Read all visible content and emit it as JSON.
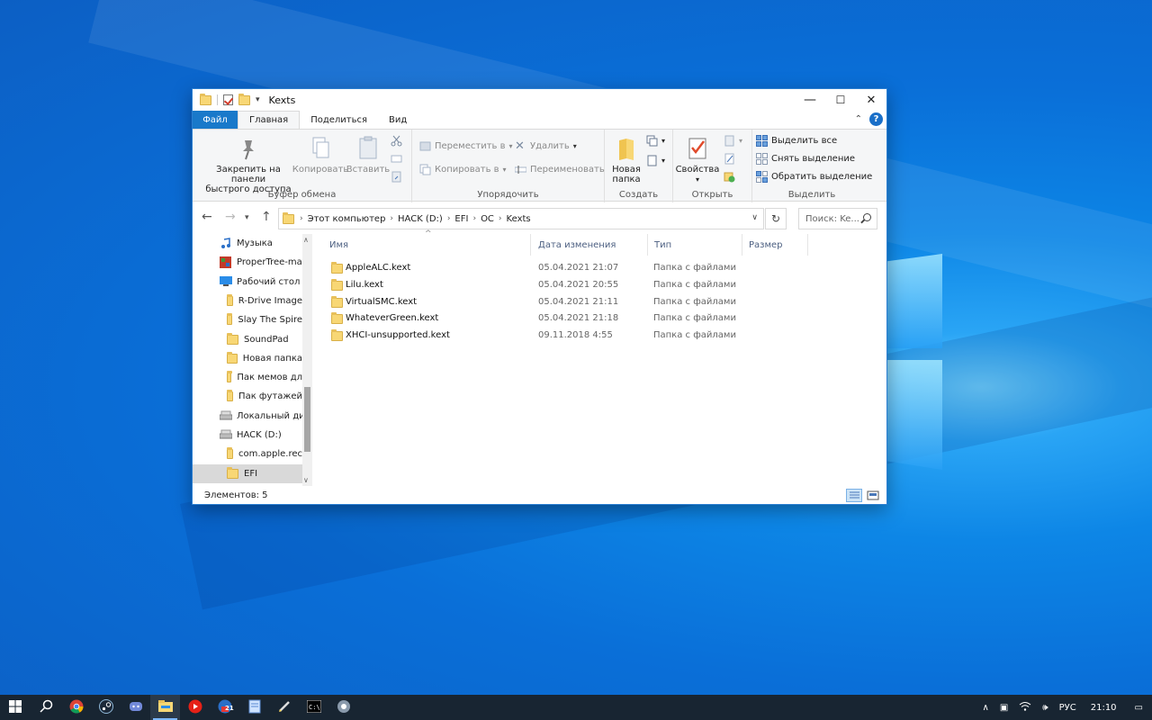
{
  "window": {
    "title": "Kexts",
    "minimize": "—",
    "maximize": "☐",
    "close": "✕"
  },
  "ribbon_tabs": [
    {
      "label": "Файл"
    },
    {
      "label": "Главная"
    },
    {
      "label": "Поделиться"
    },
    {
      "label": "Вид"
    }
  ],
  "ribbon": {
    "clipboard": {
      "group_label": "Буфер обмена",
      "pin": "Закрепить на панели быстрого доступа",
      "pin_line1": "Закрепить на панели",
      "pin_line2": "быстрого доступа",
      "copy": "Копировать",
      "paste": "Вставить"
    },
    "organize": {
      "group_label": "Упорядочить",
      "move_to": "Переместить в",
      "copy_to": "Копировать в",
      "delete": "Удалить",
      "rename": "Переименовать"
    },
    "create": {
      "group_label": "Создать",
      "new_folder_line1": "Новая",
      "new_folder_line2": "папка"
    },
    "open": {
      "group_label": "Открыть",
      "properties": "Свойства"
    },
    "select": {
      "group_label": "Выделить",
      "select_all": "Выделить все",
      "select_none": "Снять выделение",
      "invert": "Обратить выделение"
    }
  },
  "address": {
    "crumbs": [
      "Этот компьютер",
      "HACK (D:)",
      "EFI",
      "OC",
      "Kexts"
    ],
    "search_placeholder": "Поиск: Ke..."
  },
  "nav_pane": [
    {
      "label": "Музыка",
      "icon": "music-icon"
    },
    {
      "label": "ProperTree-ma",
      "icon": "app-icon"
    },
    {
      "label": "Рабочий стол",
      "icon": "desktop-icon"
    },
    {
      "label": "R-Drive Image",
      "icon": "folder-icon"
    },
    {
      "label": "Slay The Spire",
      "icon": "folder-icon"
    },
    {
      "label": "SoundPad",
      "icon": "folder-icon"
    },
    {
      "label": "Новая папка",
      "icon": "folder-icon"
    },
    {
      "label": "Пак мемов дл",
      "icon": "folder-icon"
    },
    {
      "label": "Пак футажей",
      "icon": "folder-icon"
    },
    {
      "label": "Локальный дис",
      "icon": "drive-icon"
    },
    {
      "label": "HACK (D:)",
      "icon": "drive-icon"
    },
    {
      "label": "com.apple.rec",
      "icon": "folder-icon"
    },
    {
      "label": "EFI",
      "icon": "folder-icon",
      "selected": true
    }
  ],
  "columns": {
    "name": "Имя",
    "date": "Дата изменения",
    "type": "Тип",
    "size": "Размер"
  },
  "files": [
    {
      "name": "AppleALC.kext",
      "date": "05.04.2021 21:07",
      "type": "Папка с файлами"
    },
    {
      "name": "Lilu.kext",
      "date": "05.04.2021 20:55",
      "type": "Папка с файлами"
    },
    {
      "name": "VirtualSMC.kext",
      "date": "05.04.2021 21:11",
      "type": "Папка с файлами"
    },
    {
      "name": "WhateverGreen.kext",
      "date": "05.04.2021 21:18",
      "type": "Папка с файлами"
    },
    {
      "name": "XHCI-unsupported.kext",
      "date": "09.11.2018 4:55",
      "type": "Папка с файлами"
    }
  ],
  "status": {
    "items_count": "Элементов: 5"
  },
  "taskbar": {
    "apps": [
      "start-icon",
      "search-icon",
      "chrome-icon",
      "steam-icon",
      "discord-icon",
      "explorer-icon",
      "youtube-music-icon",
      "calendar-icon",
      "notepad-icon",
      "pen-icon",
      "terminal-icon",
      "app-icon"
    ],
    "calendar_badge": "21",
    "lang": "РУС",
    "time": "21:10"
  },
  "colors": {
    "accent": "#1979ca",
    "taskbar": "#182532",
    "folder": "#f8d775",
    "column_header": "#4d6082"
  }
}
